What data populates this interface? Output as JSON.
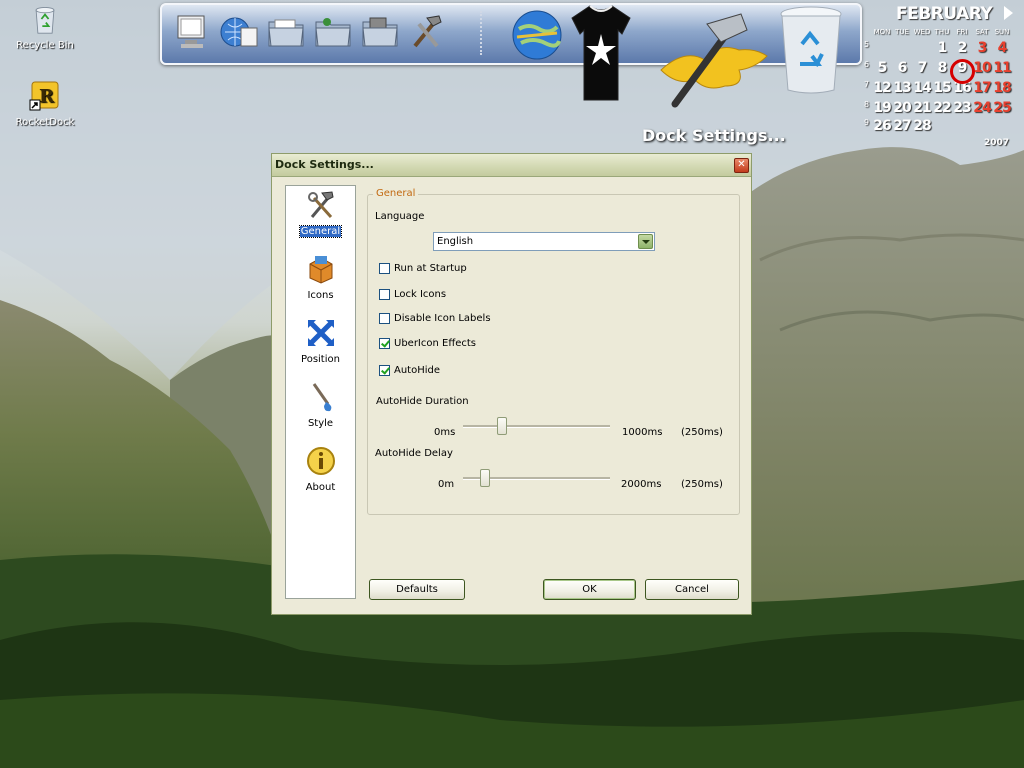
{
  "desktop": {
    "icons": [
      {
        "label": "Recycle Bin"
      },
      {
        "label": "RocketDock"
      }
    ]
  },
  "dock": {
    "hover_label": "Dock Settings...",
    "items": [
      "computer-icon",
      "network-icon",
      "folder-docs-icon",
      "folder-music-icon",
      "folder-pictures-icon",
      "tools-icon",
      "globe-icon",
      "tshirt-icon",
      "settings-hammer-icon",
      "recycle-bin-icon"
    ]
  },
  "calendar": {
    "month": "FEBRUARY",
    "year": "2007",
    "day_names": [
      "MON",
      "TUE",
      "WED",
      "THU",
      "FRI",
      "SAT",
      "SUN"
    ],
    "week_numbers": [
      "5",
      "6",
      "7",
      "8",
      "9"
    ],
    "weeks": [
      [
        "",
        "",
        "",
        "1",
        "2",
        "3",
        "4"
      ],
      [
        "5",
        "6",
        "7",
        "8",
        "9",
        "10",
        "11"
      ],
      [
        "12",
        "13",
        "14",
        "15",
        "16",
        "17",
        "18"
      ],
      [
        "19",
        "20",
        "21",
        "22",
        "23",
        "24",
        "25"
      ],
      [
        "26",
        "27",
        "28",
        "",
        "",
        "",
        ""
      ]
    ],
    "today": "9",
    "weekend_color": "#e8402e"
  },
  "dialog": {
    "title": "Dock Settings...",
    "close_glyph": "✕",
    "sidebar": [
      {
        "label": "General",
        "active": true
      },
      {
        "label": "Icons"
      },
      {
        "label": "Position"
      },
      {
        "label": "Style"
      },
      {
        "label": "About"
      }
    ],
    "group_title": "General",
    "language_label": "Language",
    "language_value": "English",
    "checkboxes": [
      {
        "label": "Run at Startup",
        "checked": false
      },
      {
        "label": "Lock Icons",
        "checked": false
      },
      {
        "label": "Disable Icon Labels",
        "checked": false
      },
      {
        "label": "UberIcon Effects",
        "checked": true
      },
      {
        "label": "AutoHide",
        "checked": true
      }
    ],
    "autohide_duration": {
      "label": "AutoHide Duration",
      "min": "0ms",
      "max": "1000ms",
      "current": "(250ms)",
      "value_fraction": 0.25
    },
    "autohide_delay": {
      "label": "AutoHide Delay",
      "min": "0m",
      "max": "2000ms",
      "current": "(250ms)",
      "value_fraction": 0.125
    },
    "buttons": {
      "defaults": "Defaults",
      "ok": "OK",
      "cancel": "Cancel"
    }
  }
}
